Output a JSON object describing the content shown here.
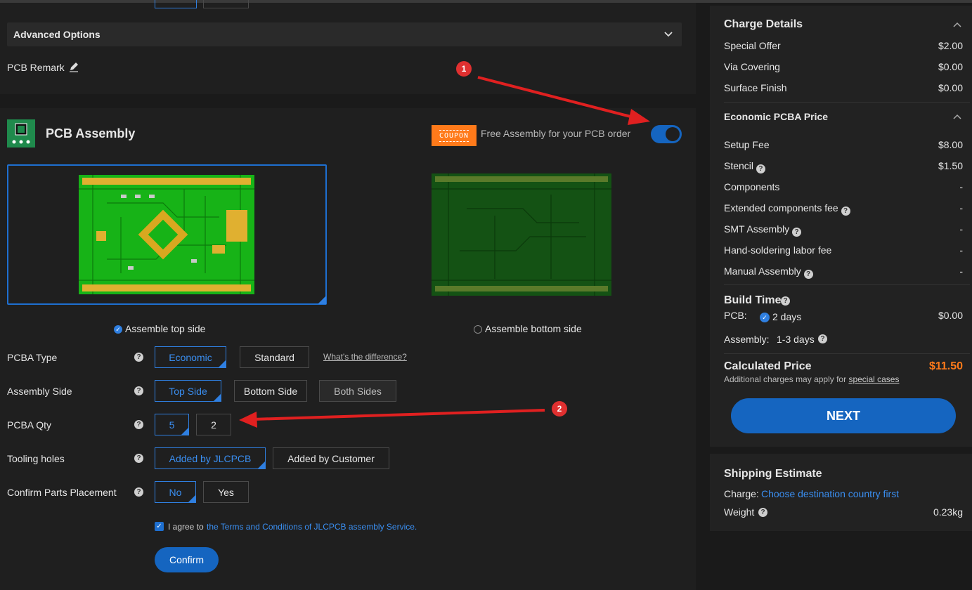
{
  "advanced_options": {
    "title": "Advanced Options"
  },
  "pcb_remark": {
    "label": "PCB Remark"
  },
  "assembly": {
    "title": "PCB Assembly",
    "coupon_badge": "COUPON",
    "free_text": "Free Assembly for your PCB order",
    "toggle_on": true,
    "top_side_label": "Assemble top side",
    "bottom_side_label": "Assemble bottom side",
    "pcba_type": {
      "label": "PCBA Type",
      "options": [
        "Economic",
        "Standard"
      ],
      "selected": "Economic",
      "link": "What's the difference?"
    },
    "assembly_side": {
      "label": "Assembly Side",
      "options": [
        "Top Side",
        "Bottom Side",
        "Both Sides"
      ],
      "selected": "Top Side"
    },
    "pcba_qty": {
      "label": "PCBA Qty",
      "options": [
        "5",
        "2"
      ],
      "selected": "5"
    },
    "tooling_holes": {
      "label": "Tooling holes",
      "options": [
        "Added by JLCPCB",
        "Added by Customer"
      ],
      "selected": "Added by JLCPCB"
    },
    "confirm_parts": {
      "label": "Confirm Parts Placement",
      "options": [
        "No",
        "Yes"
      ],
      "selected": "No"
    },
    "agree_prefix": "I agree to",
    "agree_link": "the Terms and Conditions of JLCPCB assembly Service.",
    "confirm_button": "Confirm"
  },
  "annotations": {
    "one": "1",
    "two": "2"
  },
  "charge": {
    "title": "Charge Details",
    "rows": [
      {
        "label": "Special Offer",
        "value": "$2.00"
      },
      {
        "label": "Via Covering",
        "value": "$0.00"
      },
      {
        "label": "Surface Finish",
        "value": "$0.00"
      }
    ],
    "pcba_title": "Economic PCBA Price",
    "pcba_rows": [
      {
        "label": "Setup Fee",
        "value": "$8.00"
      },
      {
        "label": "Stencil",
        "value": "$1.50"
      },
      {
        "label": "Components",
        "value": "-"
      },
      {
        "label": "Extended components fee",
        "value": "-"
      },
      {
        "label": "SMT Assembly",
        "value": "-"
      },
      {
        "label": "Hand-soldering labor fee",
        "value": "-"
      },
      {
        "label": "Manual Assembly",
        "value": "-"
      }
    ],
    "build_time_title": "Build Time",
    "pcb_label": "PCB:",
    "pcb_days": "2 days",
    "pcb_price": "$0.00",
    "assembly_label": "Assembly:",
    "assembly_days": "1-3 days",
    "calculated_label": "Calculated Price",
    "calculated_value": "$11.50",
    "note_prefix": "Additional charges may apply for",
    "note_link": "special cases",
    "next_button": "NEXT"
  },
  "shipping": {
    "title": "Shipping Estimate",
    "charge_label": "Charge:",
    "charge_link": "Choose destination country first",
    "weight_label": "Weight",
    "weight_value": "0.23kg"
  },
  "colors": {
    "accent": "#2f7fe0",
    "price": "#ff7a1a",
    "annotation": "#e03030",
    "coupon": "#ff7a1a"
  }
}
